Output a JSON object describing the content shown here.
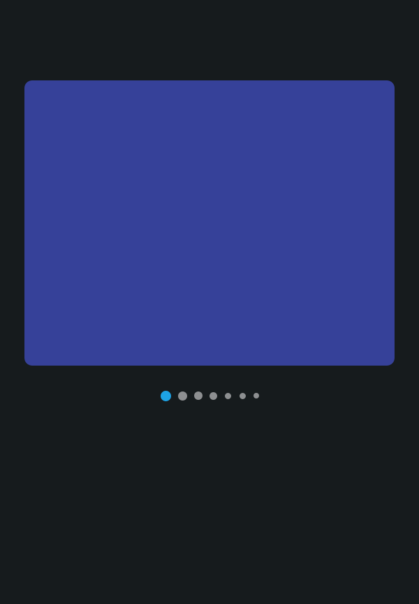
{
  "colors": {
    "background": "#161b1d",
    "slide": "#364199",
    "dot_active": "#1da3e6",
    "dot_inactive": "#8d8f91"
  },
  "carousel": {
    "slide_count": 7,
    "active_index": 0
  }
}
